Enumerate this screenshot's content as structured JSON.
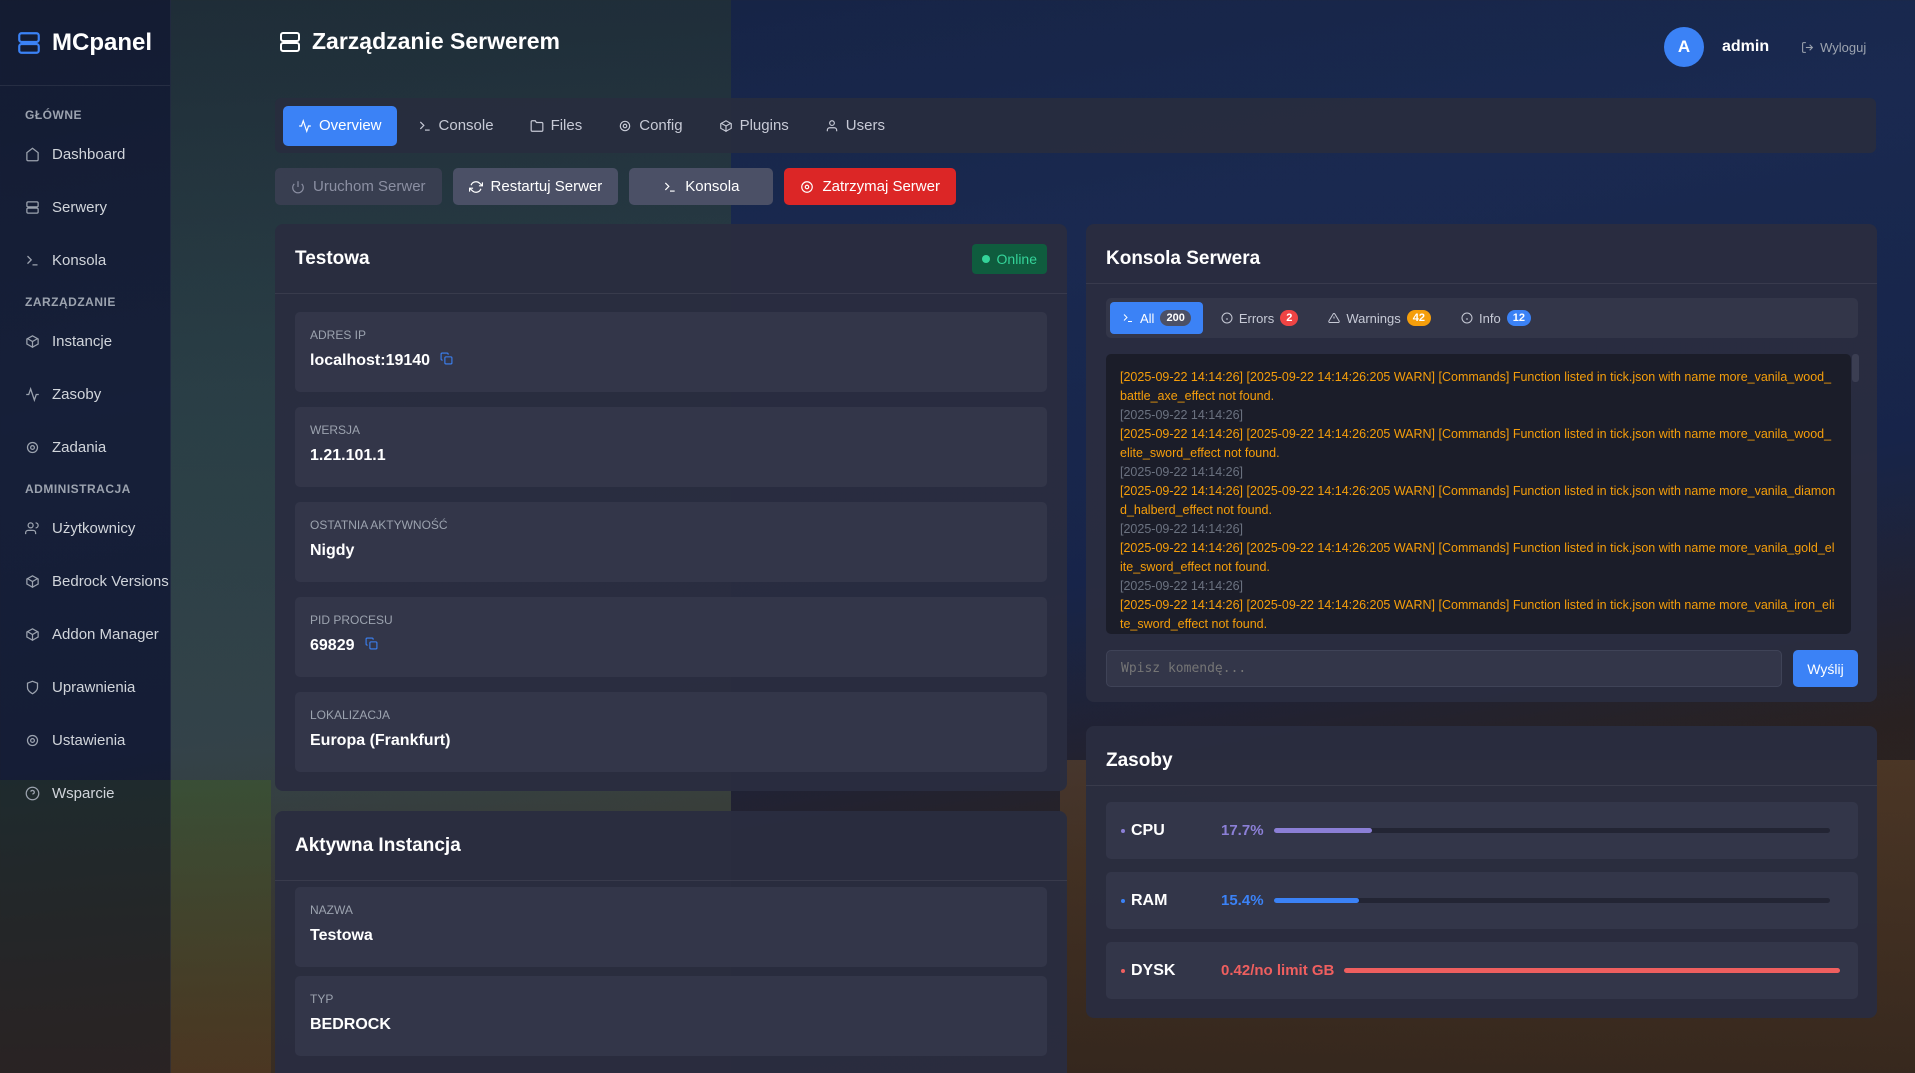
{
  "brand": {
    "name": "MCpanel"
  },
  "sidebar": {
    "sections": [
      {
        "title": "GŁÓWNE",
        "items": [
          {
            "label": "Dashboard",
            "icon": "home-icon"
          },
          {
            "label": "Serwery",
            "icon": "server-icon"
          },
          {
            "label": "Konsola",
            "icon": "terminal-icon"
          }
        ]
      },
      {
        "title": "ZARZĄDZANIE",
        "items": [
          {
            "label": "Instancje",
            "icon": "box-icon"
          },
          {
            "label": "Zasoby",
            "icon": "activity-icon"
          },
          {
            "label": "Zadania",
            "icon": "gear-icon"
          }
        ]
      },
      {
        "title": "ADMINISTRACJA",
        "items": [
          {
            "label": "Użytkownicy",
            "icon": "users-icon"
          },
          {
            "label": "Bedrock Versions",
            "icon": "box-icon"
          },
          {
            "label": "Addon Manager",
            "icon": "box-icon"
          },
          {
            "label": "Uprawnienia",
            "icon": "shield-icon"
          },
          {
            "label": "Ustawienia",
            "icon": "gear-icon"
          },
          {
            "label": "Wsparcie",
            "icon": "help-icon"
          }
        ]
      }
    ]
  },
  "header": {
    "title": "Zarządzanie Serwerem",
    "avatar_letter": "A",
    "username": "admin",
    "logout": "Wyloguj"
  },
  "tabs": [
    {
      "label": "Overview",
      "icon": "activity-icon",
      "active": true
    },
    {
      "label": "Console",
      "icon": "terminal-icon"
    },
    {
      "label": "Files",
      "icon": "folder-icon"
    },
    {
      "label": "Config",
      "icon": "gear-icon"
    },
    {
      "label": "Plugins",
      "icon": "box-icon"
    },
    {
      "label": "Users",
      "icon": "user-icon"
    }
  ],
  "actions": {
    "start": "Uruchom Serwer",
    "restart": "Restartuj Serwer",
    "console": "Konsola",
    "stop": "Zatrzymaj Serwer"
  },
  "server": {
    "name": "Testowa",
    "status": "Online",
    "fields": [
      {
        "label": "ADRES IP",
        "value": "localhost:19140",
        "copy": true
      },
      {
        "label": "WERSJA",
        "value": "1.21.101.1"
      },
      {
        "label": "OSTATNIA AKTYWNOŚĆ",
        "value": "Nigdy"
      },
      {
        "label": "PID PROCESU",
        "value": "69829",
        "copy": true
      },
      {
        "label": "LOKALIZACJA",
        "value": "Europa (Frankfurt)"
      }
    ]
  },
  "instance": {
    "title": "Aktywna Instancja",
    "fields": [
      {
        "label": "NAZWA",
        "value": "Testowa"
      },
      {
        "label": "TYP",
        "value": "BEDROCK"
      }
    ]
  },
  "console": {
    "title": "Konsola Serwera",
    "filters": [
      {
        "label": "All",
        "count": "200",
        "color": "#4b5066"
      },
      {
        "label": "Errors",
        "count": "2",
        "color": "#ef4444"
      },
      {
        "label": "Warnings",
        "count": "42",
        "color": "#f59e0b"
      },
      {
        "label": "Info",
        "count": "12",
        "color": "#3b82f6"
      }
    ],
    "lines": [
      {
        "type": "warn",
        "text": "[2025-09-22 14:14:26] [2025-09-22 14:14:26:205 WARN] [Commands] Function listed in tick.json with name more_vanila_wood_battle_axe_effect not found."
      },
      {
        "type": "ts",
        "text": "[2025-09-22 14:14:26]"
      },
      {
        "type": "warn",
        "text": "[2025-09-22 14:14:26] [2025-09-22 14:14:26:205 WARN] [Commands] Function listed in tick.json with name more_vanila_wood_elite_sword_effect not found."
      },
      {
        "type": "ts",
        "text": "[2025-09-22 14:14:26]"
      },
      {
        "type": "warn",
        "text": "[2025-09-22 14:14:26] [2025-09-22 14:14:26:205 WARN] [Commands] Function listed in tick.json with name more_vanila_diamond_halberd_effect not found."
      },
      {
        "type": "ts",
        "text": "[2025-09-22 14:14:26]"
      },
      {
        "type": "warn",
        "text": "[2025-09-22 14:14:26] [2025-09-22 14:14:26:205 WARN] [Commands] Function listed in tick.json with name more_vanila_gold_elite_sword_effect not found."
      },
      {
        "type": "ts",
        "text": "[2025-09-22 14:14:26]"
      },
      {
        "type": "warn",
        "text": "[2025-09-22 14:14:26] [2025-09-22 14:14:26:205 WARN] [Commands] Function listed in tick.json with name more_vanila_iron_elite_sword_effect not found."
      }
    ],
    "placeholder": "Wpisz komendę...",
    "send": "Wyślij"
  },
  "resources": {
    "title": "Zasoby",
    "items": [
      {
        "name": "CPU",
        "value": "17.7%",
        "fraction": 0.177,
        "color": "#8b7fd6"
      },
      {
        "name": "RAM",
        "value": "15.4%",
        "fraction": 0.154,
        "color": "#3b82f6"
      },
      {
        "name": "DYSK",
        "value": "0.42/no limit GB",
        "fraction": 1.0,
        "color": "#ef5f5f"
      }
    ]
  }
}
